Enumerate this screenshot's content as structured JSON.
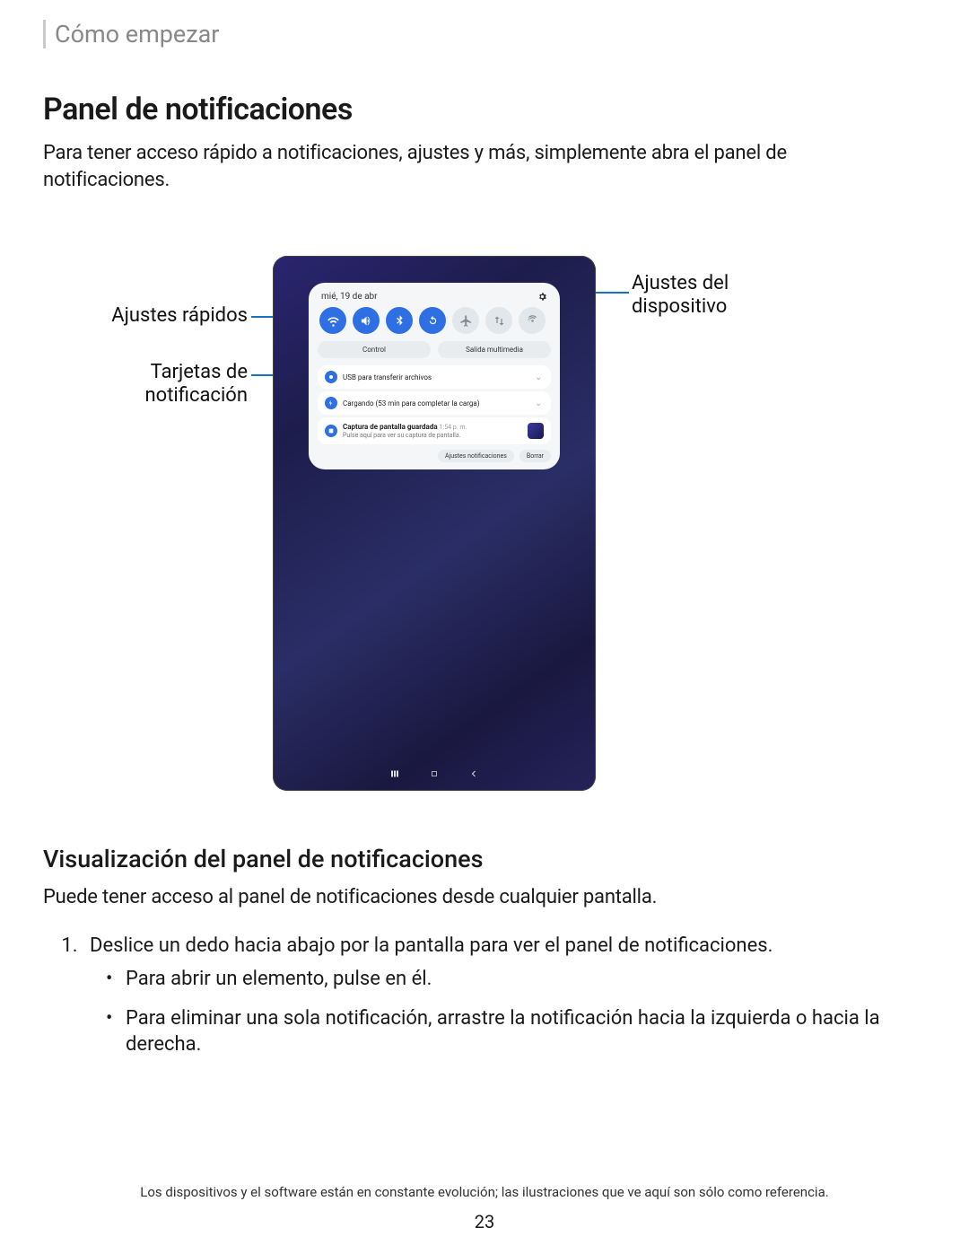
{
  "breadcrumb": "Cómo empezar",
  "title": "Panel de notificaciones",
  "intro": "Para tener acceso rápido a notificaciones, ajustes y más, simplemente abra el panel de notificaciones.",
  "callouts": {
    "quick_settings": "Ajustes rápidos",
    "notification_cards": "Tarjetas de notificación",
    "device_settings": "Ajustes del dispositivo"
  },
  "panel": {
    "date": "mié, 19 de abr",
    "quick_toggles": [
      {
        "name": "wifi-icon",
        "active": true
      },
      {
        "name": "sound-icon",
        "active": true
      },
      {
        "name": "bluetooth-icon",
        "active": true
      },
      {
        "name": "rotate-icon",
        "active": true
      },
      {
        "name": "airplane-icon",
        "active": false
      },
      {
        "name": "updown-icon",
        "active": false
      },
      {
        "name": "antenna-icon",
        "active": false
      }
    ],
    "segments": {
      "devices": "Control",
      "media": "Salida multimedia"
    },
    "notifications": [
      {
        "icon": "usb-icon",
        "title": "USB para transferir archivos",
        "subtitle": "",
        "thumb": false
      },
      {
        "icon": "battery-icon",
        "title": "Cargando (53 min para completar la carga)",
        "subtitle": "",
        "thumb": false
      },
      {
        "icon": "screenshot-icon",
        "title": "Captura de pantalla guardada",
        "timestamp": "1:54 p. m.",
        "subtitle": "Pulse aquí para ver su captura de pantalla.",
        "thumb": true
      }
    ],
    "footer": {
      "settings": "Ajustes notificaciones",
      "clear": "Borrar"
    }
  },
  "subhead": "Visualización del panel de notificaciones",
  "body2": "Puede tener acceso al panel de notificaciones desde cualquier pantalla.",
  "list": {
    "step1": "Deslice un dedo hacia abajo por la pantalla para ver el panel de notificaciones.",
    "bullets": [
      "Para abrir un elemento, pulse en él.",
      "Para eliminar una sola notificación, arrastre la notificación hacia la izquierda o hacia la derecha."
    ]
  },
  "footnote": "Los dispositivos y el software están en constante evolución; las ilustraciones que ve aquí son sólo como referencia.",
  "page_number": "23"
}
